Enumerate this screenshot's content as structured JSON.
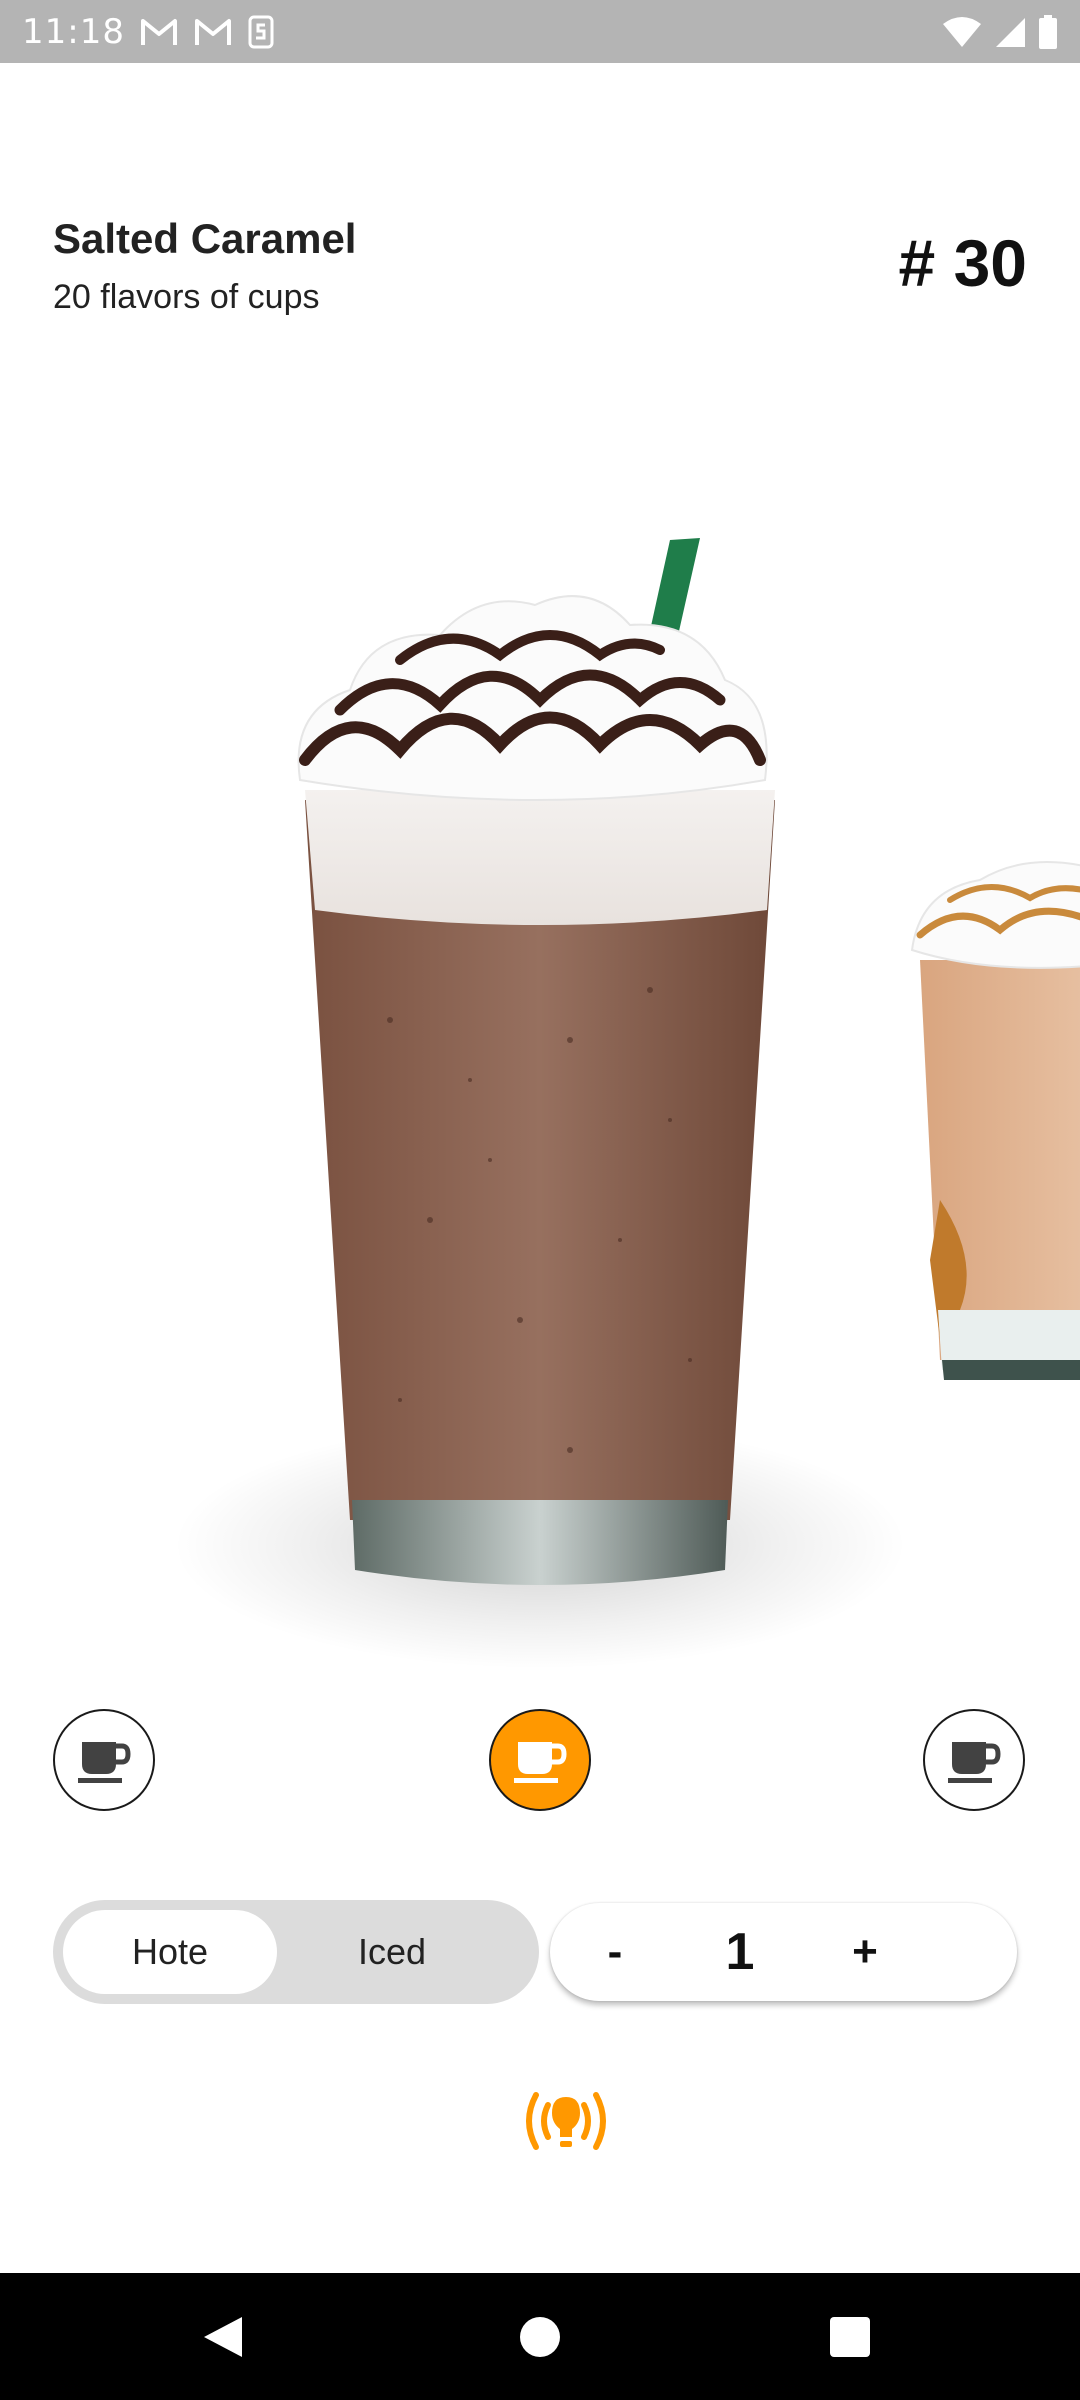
{
  "status_bar": {
    "time": "11:18",
    "notification_icons": [
      "gmail-icon",
      "gmail-icon",
      "sim-toolkit-icon"
    ],
    "system_icons": [
      "wifi-icon",
      "cellular-signal-icon",
      "battery-icon"
    ]
  },
  "product": {
    "name": "Salted Caramel",
    "subtitle": "20 flavors of cups",
    "number": "# 30"
  },
  "carousel": {
    "current_image": "chocolate-frappuccino-image",
    "next_image": "caramel-frappuccino-image"
  },
  "cup_selector": {
    "items": [
      {
        "icon": "coffee-cup-icon",
        "active": false
      },
      {
        "icon": "coffee-cup-icon",
        "active": true
      },
      {
        "icon": "coffee-cup-icon",
        "active": false
      }
    ],
    "active_color": "#ff9800"
  },
  "temperature": {
    "options": [
      "Hote",
      "Iced"
    ],
    "selected": "Hote"
  },
  "quantity": {
    "minus": "-",
    "value": "1",
    "plus": "+"
  },
  "beacon": {
    "icon": "broadcast-lightbulb-icon",
    "color": "#ff9800"
  },
  "nav_bar": {
    "buttons": [
      "back-icon",
      "home-icon",
      "recents-icon"
    ]
  }
}
